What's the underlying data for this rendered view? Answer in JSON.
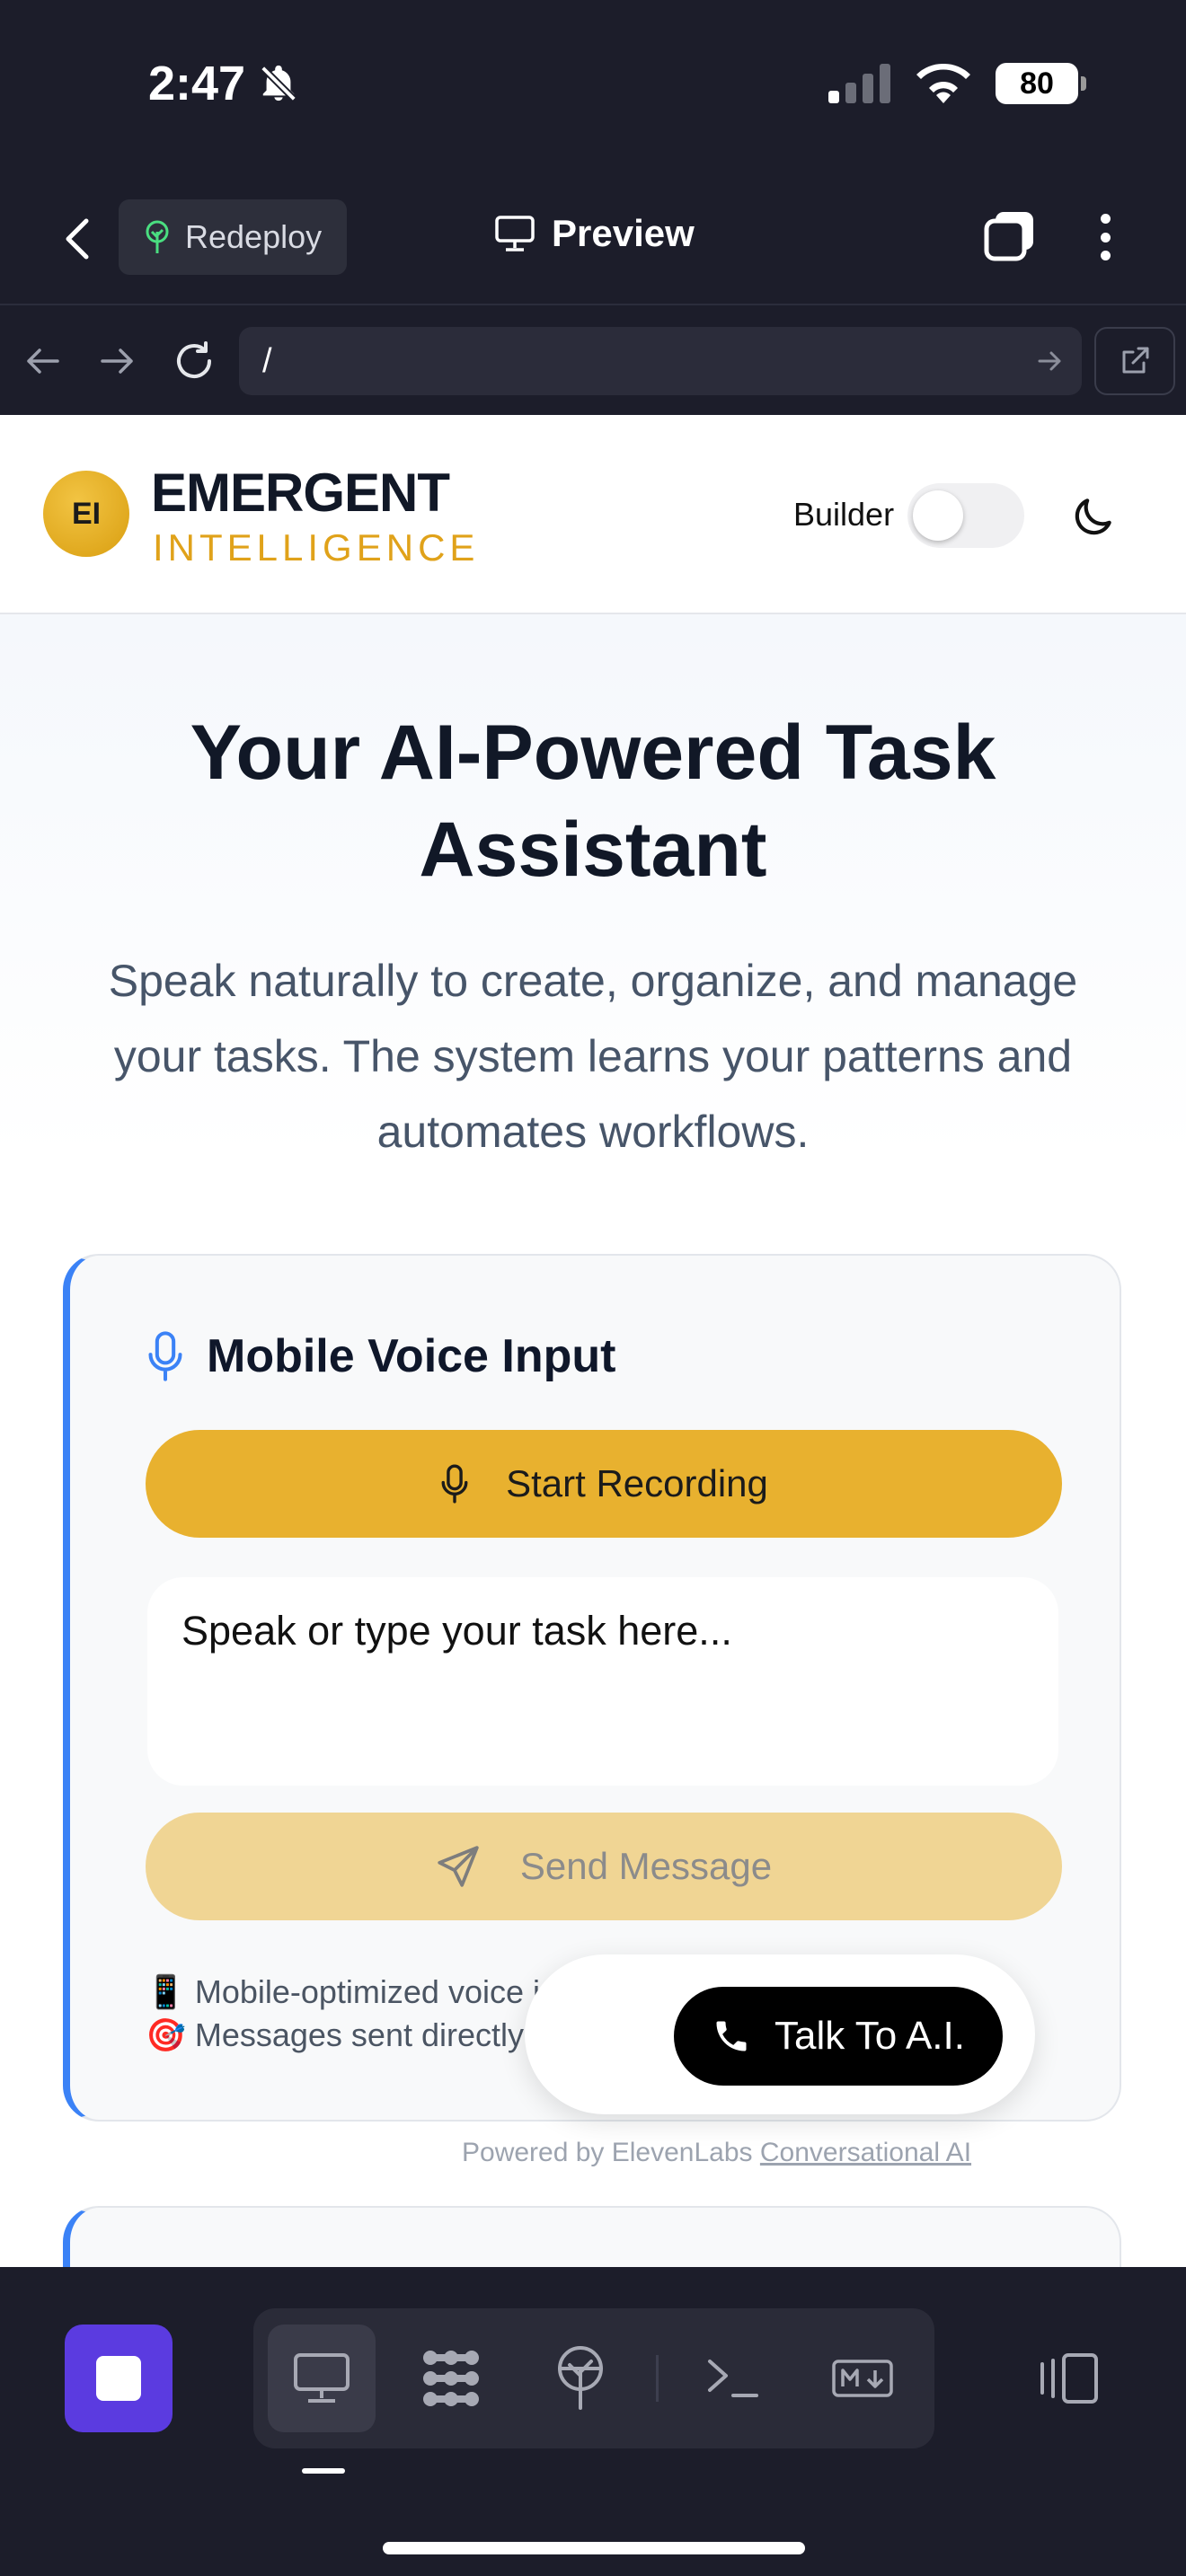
{
  "status": {
    "time": "2:47",
    "battery": "80"
  },
  "toolbar": {
    "redeploy_label": "Redeploy",
    "preview_label": "Preview"
  },
  "browser": {
    "url": "/"
  },
  "site": {
    "logo_initials": "EI",
    "logo_title": "EMERGENT",
    "logo_subtitle": "INTELLIGENCE",
    "builder_label": "Builder",
    "builder_toggle_on": false
  },
  "hero": {
    "title_line1": "Your AI-Powered Task",
    "title_line2": "Assistant",
    "subtitle_line1": "Speak naturally to create, organize, and manage",
    "subtitle_line2": "your tasks. The system learns your patterns and",
    "subtitle_line3": "automates workflows."
  },
  "voice_card": {
    "title": "Mobile Voice Input",
    "record_label": "Start Recording",
    "input_placeholder": "Speak or type your task here...",
    "send_label": "Send Message",
    "note1_icon": "📱",
    "note1": "Mobile-optimized voice i",
    "note2_icon": "🎯",
    "note2": "Messages sent directly"
  },
  "widget": {
    "talk_label": "Talk To A.I.",
    "powered_prefix": "Powered by ElevenLabs",
    "powered_link": "Conversational AI"
  },
  "colors": {
    "accent": "#e8b12f",
    "accent_muted": "#f0d594",
    "card_border": "#3b82f6",
    "ide_primary": "#5b3be0"
  },
  "icons": [
    "bell-slash-icon",
    "signal-icon",
    "wifi-icon",
    "back-chevron-icon",
    "tree-icon",
    "monitor-icon",
    "tabs-icon",
    "more-vertical-icon",
    "arrow-left-icon",
    "arrow-right-icon",
    "reload-icon",
    "external-link-icon",
    "moon-icon",
    "microphone-icon",
    "send-icon",
    "phone-icon",
    "stop-icon",
    "grid-icon",
    "deploy-icon",
    "terminal-icon",
    "markdown-icon",
    "device-toggle-icon"
  ]
}
